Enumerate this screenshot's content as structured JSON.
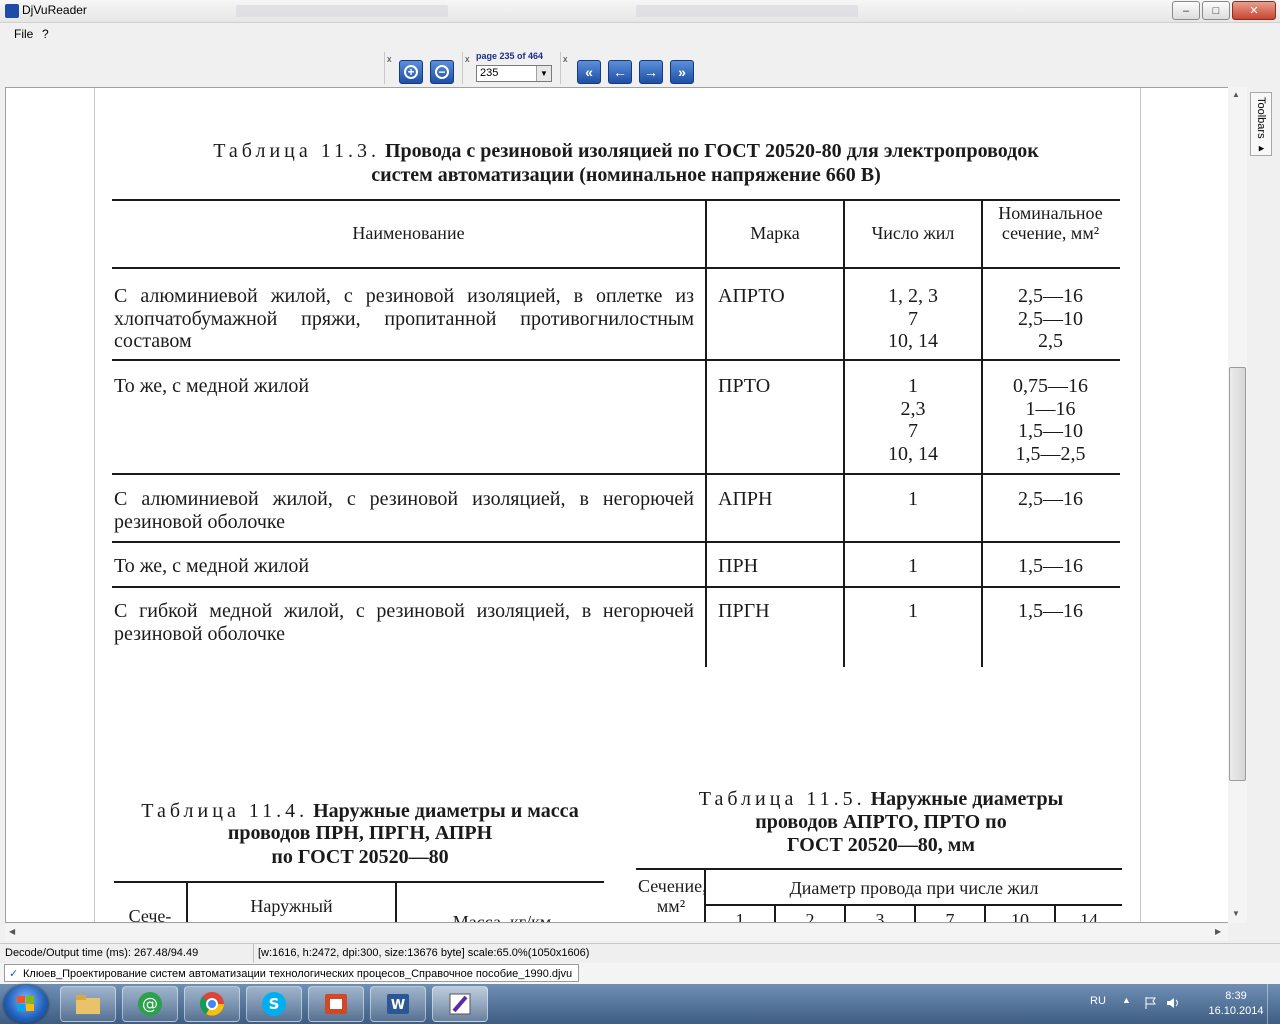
{
  "window": {
    "title": "DjVuReader",
    "controls": {
      "minimize": "–",
      "maximize": "□",
      "close": "✕"
    }
  },
  "menu": {
    "items": [
      "File",
      "?"
    ]
  },
  "toolbar": {
    "zoom_in_icon": "⊕",
    "zoom_out_icon": "⊖",
    "page_label": "page 235 of 464",
    "page_value": "235",
    "nav": {
      "first": "«",
      "prev": "←",
      "next": "→",
      "last": "»"
    },
    "close_glyph": "x"
  },
  "side_tab": {
    "label": "Toolbars ▸"
  },
  "document": {
    "table_11_3": {
      "caption_lead": "Таблица 11.3.",
      "caption_line1": "Провода с резиновой изоляцией по ГОСТ 20520-80 для электропроводок",
      "caption_line2": "систем автоматизации (номинальное напряжение 660 В)",
      "headers": {
        "name": "Наименование",
        "mark": "Марка",
        "cores": "Число жил",
        "section": "Номинальное сечение, мм²"
      },
      "rows": [
        {
          "name": "С алюминиевой жилой, с резиновой изоляцией, в оплетке из хлопчатобумажной пряжи, пропитанной противогнилостным составом",
          "mark": "АПРТО",
          "cores": [
            "1, 2, 3",
            "7",
            "10, 14"
          ],
          "section": [
            "2,5—16",
            "2,5—10",
            "2,5"
          ]
        },
        {
          "name": "То же, с медной жилой",
          "mark": "ПРТО",
          "cores": [
            "1",
            "2,3",
            "7",
            "10, 14"
          ],
          "section": [
            "0,75—16",
            "1—16",
            "1,5—10",
            "1,5—2,5"
          ]
        },
        {
          "name": "С алюминиевой жилой, с резиновой изоляцией, в негорючей резиновой оболочке",
          "mark": "АПРН",
          "cores": [
            "1"
          ],
          "section": [
            "2,5—16"
          ]
        },
        {
          "name": "То же, с медной жилой",
          "mark": "ПРН",
          "cores": [
            "1"
          ],
          "section": [
            "1,5—16"
          ]
        },
        {
          "name": "С гибкой медной жилой, с резиновой изоляцией, в негорючей резиновой оболочке",
          "mark": "ПРГН",
          "cores": [
            "1"
          ],
          "section": [
            "1,5—16"
          ]
        }
      ]
    },
    "table_11_4": {
      "caption_lead": "Таблица 11.4.",
      "caption_line1": "Наружные диаметры и масса",
      "caption_line2": "проводов ПРН, ПРГН, АПРН",
      "caption_line3": "по ГОСТ 20520—80",
      "headers": {
        "section": "Сече-",
        "diameter": "Наружный",
        "mass": "Масса, кг/км"
      }
    },
    "table_11_5": {
      "caption_lead": "Таблица 11.5.",
      "caption_line1": "Наружные диаметры",
      "caption_line2": "проводов АПРТО, ПРТО по",
      "caption_line3": "ГОСТ 20520—80, мм",
      "headers": {
        "section": "Сечение, мм²",
        "diameter": "Диаметр провода при числе жил",
        "cores": [
          "1",
          "2",
          "3",
          "7",
          "10",
          "14"
        ]
      }
    }
  },
  "statusbar": {
    "decode": "Decode/Output time (ms): 267.48/94.49",
    "info": "[w:1616, h:2472, dpi:300, size:13676 byte] scale:65.0%(1050x1606)"
  },
  "file_tab": {
    "label": "Клюев_Проектирование систем автоматизации технологических процесов_Справочное пособие_1990.djvu"
  },
  "taskbar": {
    "tray_lang": "RU",
    "time": "8:39",
    "date": "16.10.2014"
  }
}
